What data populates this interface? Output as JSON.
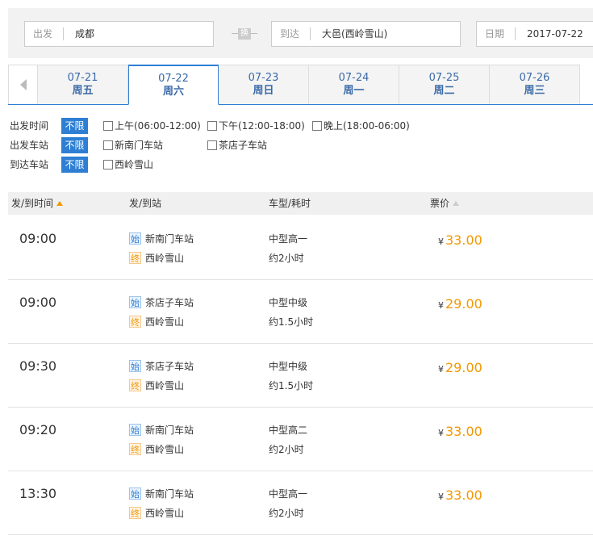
{
  "search": {
    "from_label": "出发",
    "from_value": "成都",
    "swap_label": "换",
    "to_label": "到达",
    "to_value": "大邑(西岭雪山)",
    "date_label": "日期",
    "date_value": "2017-07-22"
  },
  "dates": [
    {
      "date": "07-21",
      "weekday": "周五"
    },
    {
      "date": "07-22",
      "weekday": "周六",
      "active": true
    },
    {
      "date": "07-23",
      "weekday": "周日"
    },
    {
      "date": "07-24",
      "weekday": "周一"
    },
    {
      "date": "07-25",
      "weekday": "周二"
    },
    {
      "date": "07-26",
      "weekday": "周三"
    }
  ],
  "filters": {
    "unlimited_label": "不限",
    "depart_time": {
      "label": "出发时间",
      "options": [
        "上午(06:00-12:00)",
        "下午(12:00-18:00)",
        "晚上(18:00-06:00)"
      ]
    },
    "depart_station": {
      "label": "出发车站",
      "options": [
        "新南门车站",
        "茶店子车站"
      ]
    },
    "arrive_station": {
      "label": "到达车站",
      "options": [
        "西岭雪山"
      ]
    }
  },
  "table": {
    "headers": {
      "time": "发/到时间",
      "station": "发/到站",
      "type": "车型/耗时",
      "price": "票价"
    },
    "start_icon": "始",
    "end_icon": "终",
    "currency": "¥",
    "rows": [
      {
        "time": "09:00",
        "from": "新南门车站",
        "to": "西岭雪山",
        "bus": "中型高一",
        "duration": "约2小时",
        "price": "33.00"
      },
      {
        "time": "09:00",
        "from": "茶店子车站",
        "to": "西岭雪山",
        "bus": "中型中级",
        "duration": "约1.5小时",
        "price": "29.00"
      },
      {
        "time": "09:30",
        "from": "茶店子车站",
        "to": "西岭雪山",
        "bus": "中型中级",
        "duration": "约1.5小时",
        "price": "29.00"
      },
      {
        "time": "09:20",
        "from": "新南门车站",
        "to": "西岭雪山",
        "bus": "中型高二",
        "duration": "约2小时",
        "price": "33.00"
      },
      {
        "time": "13:30",
        "from": "新南门车站",
        "to": "西岭雪山",
        "bus": "中型高一",
        "duration": "约2小时",
        "price": "33.00"
      }
    ]
  },
  "colors": {
    "accent": "#2e7fd3",
    "price": "#f39800"
  }
}
